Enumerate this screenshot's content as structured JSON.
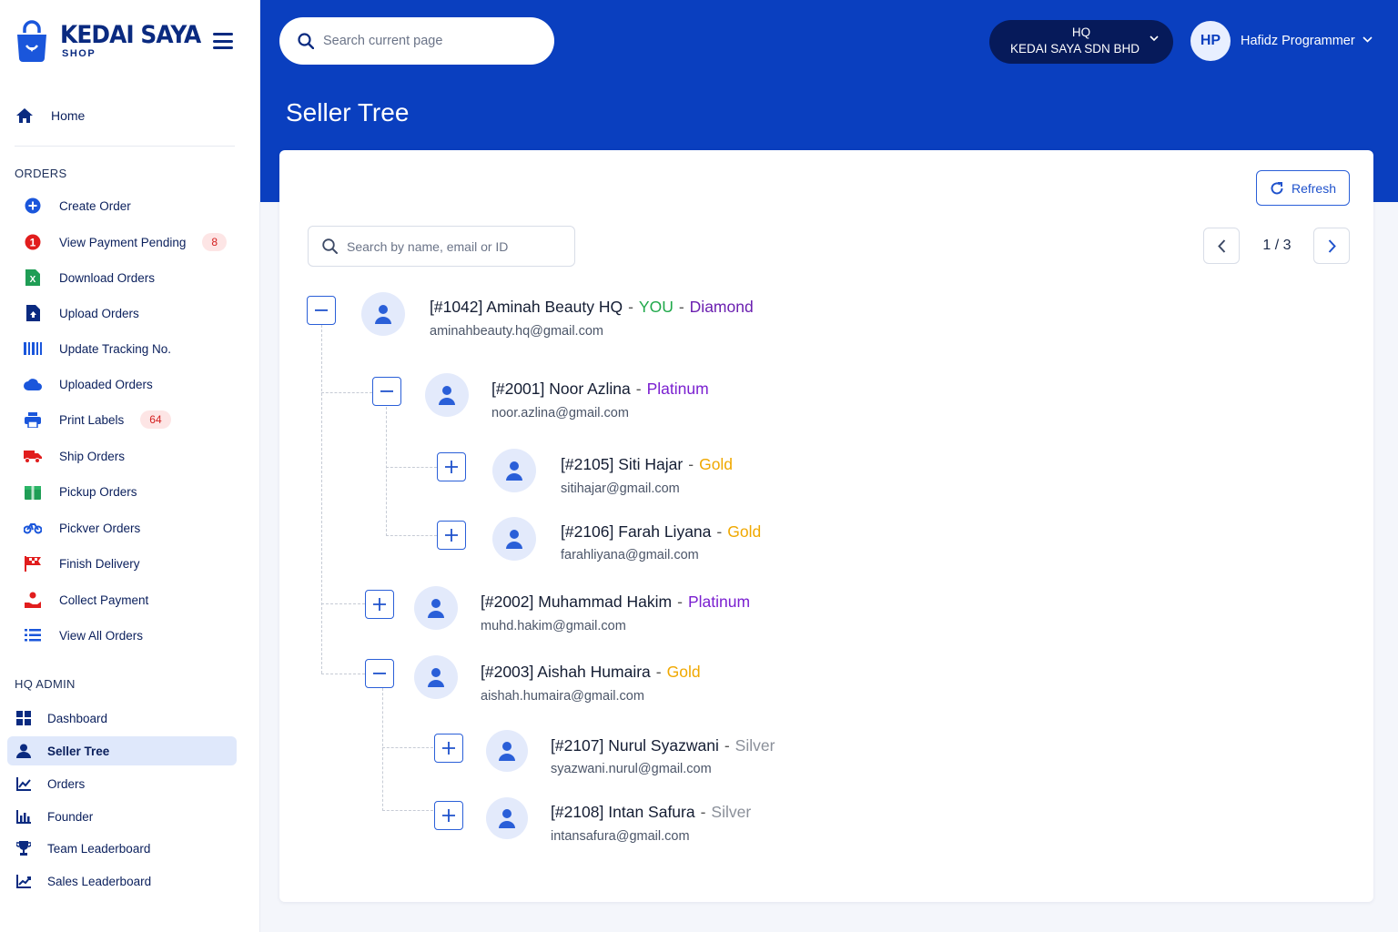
{
  "brand": {
    "name": "KEDAI SAYA",
    "sub": "SHOP"
  },
  "nav": {
    "home": "Home",
    "orders_title": "ORDERS",
    "orders": [
      {
        "label": "Create Order",
        "icon": "plus-circle-icon"
      },
      {
        "label": "View Payment Pending",
        "icon": "alert-circle-icon",
        "badge": "8"
      },
      {
        "label": "Download Orders",
        "icon": "excel-icon"
      },
      {
        "label": "Upload Orders",
        "icon": "file-upload-icon"
      },
      {
        "label": "Update Tracking No.",
        "icon": "barcode-icon"
      },
      {
        "label": "Uploaded Orders",
        "icon": "cloud-icon"
      },
      {
        "label": "Print Labels",
        "icon": "printer-icon",
        "badge": "64"
      },
      {
        "label": "Ship Orders",
        "icon": "truck-icon"
      },
      {
        "label": "Pickup Orders",
        "icon": "box-icon"
      },
      {
        "label": "Pickver Orders",
        "icon": "motorcycle-icon"
      },
      {
        "label": "Finish Delivery",
        "icon": "flag-icon"
      },
      {
        "label": "Collect Payment",
        "icon": "hand-coin-icon"
      },
      {
        "label": "View All Orders",
        "icon": "list-icon"
      }
    ],
    "hq_title": "HQ ADMIN",
    "hq": [
      {
        "label": "Dashboard",
        "icon": "grid-icon"
      },
      {
        "label": "Seller Tree",
        "icon": "user-icon",
        "active": true
      },
      {
        "label": "Orders",
        "icon": "chart-line-icon"
      },
      {
        "label": "Founder",
        "icon": "bar-chart-icon"
      },
      {
        "label": "Team Leaderboard",
        "icon": "trophy-icon"
      },
      {
        "label": "Sales Leaderboard",
        "icon": "trend-icon"
      }
    ]
  },
  "header": {
    "search_placeholder": "Search current page",
    "company_line1": "HQ",
    "company_line2": "KEDAI SAYA SDN BHD",
    "user_initials": "HP",
    "user_name": "Hafidz Programmer"
  },
  "page": {
    "title": "Seller Tree",
    "refresh": "Refresh",
    "search_placeholder": "Search by name, email or ID",
    "pagination": "1 / 3"
  },
  "tree": {
    "root": {
      "name": "[#1042] Aminah Beauty HQ",
      "you": "YOU",
      "tier": "Diamond",
      "email": "aminahbeauty.hq@gmail.com"
    },
    "n2001": {
      "name": "[#2001] Noor Azlina",
      "tier": "Platinum",
      "email": "noor.azlina@gmail.com"
    },
    "n2105": {
      "name": "[#2105] Siti Hajar",
      "tier": "Gold",
      "email": "sitihajar@gmail.com"
    },
    "n2106": {
      "name": "[#2106] Farah Liyana",
      "tier": "Gold",
      "email": "farahliyana@gmail.com"
    },
    "n2002": {
      "name": "[#2002] Muhammad Hakim",
      "tier": "Platinum",
      "email": "muhd.hakim@gmail.com"
    },
    "n2003": {
      "name": "[#2003] Aishah Humaira",
      "tier": "Gold",
      "email": "aishah.humaira@gmail.com"
    },
    "n2107": {
      "name": "[#2107] Nurul Syazwani",
      "tier": "Silver",
      "email": "syazwani.nurul@gmail.com"
    },
    "n2108": {
      "name": "[#2108] Intan Safura",
      "tier": "Silver",
      "email": "intansafura@gmail.com"
    }
  },
  "colors": {
    "primary": "#0a3fbf",
    "navy": "#0a2a80",
    "diamond": "#6b1fb0",
    "platinum": "#7a1fd0",
    "gold": "#f0a800",
    "silver": "#8a8f99",
    "you": "#1fa84a"
  }
}
